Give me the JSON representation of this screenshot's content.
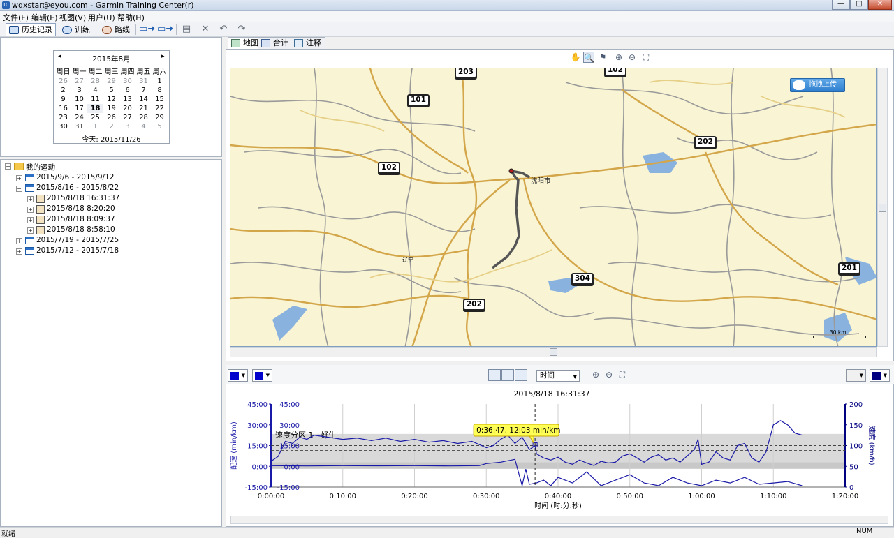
{
  "window": {
    "title": "wqxstar@eyou.com - Garmin Training Center(r)",
    "app_icon_text": "TC"
  },
  "menu": [
    "文件(F)",
    "编辑(E)",
    "视图(V)",
    "用户(U)",
    "帮助(H)"
  ],
  "toolbar": {
    "tabs": [
      "历史记录",
      "训练",
      "路线"
    ]
  },
  "calendar": {
    "month_label": "2015年8月",
    "weekdays": [
      "周日",
      "周一",
      "周二",
      "周三",
      "周四",
      "周五",
      "周六"
    ],
    "weeks": [
      [
        "26",
        "27",
        "28",
        "29",
        "30",
        "31",
        "1"
      ],
      [
        "2",
        "3",
        "4",
        "5",
        "6",
        "7",
        "8"
      ],
      [
        "9",
        "10",
        "11",
        "12",
        "13",
        "14",
        "15"
      ],
      [
        "16",
        "17",
        "18",
        "19",
        "20",
        "21",
        "22"
      ],
      [
        "23",
        "24",
        "25",
        "26",
        "27",
        "28",
        "29"
      ],
      [
        "30",
        "31",
        "1",
        "2",
        "3",
        "4",
        "5"
      ]
    ],
    "selected_day": "18",
    "today_label": "今天: 2015/11/26"
  },
  "tree": {
    "root": "我的运动",
    "nodes": [
      {
        "label": "2015/9/6 - 2015/9/12",
        "level": 1,
        "type": "week"
      },
      {
        "label": "2015/8/16 - 2015/8/22",
        "level": 1,
        "type": "week"
      },
      {
        "label": "2015/8/18 16:31:37",
        "level": 2,
        "type": "activity"
      },
      {
        "label": "2015/8/18 8:20:20",
        "level": 2,
        "type": "activity"
      },
      {
        "label": "2015/8/18 8:09:37",
        "level": 2,
        "type": "activity"
      },
      {
        "label": "2015/8/18 8:58:10",
        "level": 2,
        "type": "activity"
      },
      {
        "label": "2015/7/19 - 2015/7/25",
        "level": 1,
        "type": "week"
      },
      {
        "label": "2015/7/12 - 2015/7/18",
        "level": 1,
        "type": "week"
      }
    ]
  },
  "view_tabs": [
    "地图",
    "合计",
    "注释"
  ],
  "map": {
    "upload_button": "拖拽上传",
    "city_label": "沈阳市",
    "province_label": "辽宁",
    "scale_label": "30 km",
    "shields": [
      "203",
      "102",
      "101",
      "202",
      "102",
      "304",
      "202",
      "201"
    ]
  },
  "chart": {
    "title": "2015/8/18 16:31:37",
    "x_axis_selector": "时间",
    "tooltip": "0:36:47, 12:03 min/km",
    "zone_label": "速度分区 1 - 好生",
    "left_axis_label": "配速 (min/km)",
    "right_axis_label": "速度 (km/h)",
    "x_axis_label": "时间 (时:分:秒)",
    "left_ticks_outer": [
      "45:00",
      "30:00",
      "15:00",
      "0:00",
      "-15:00"
    ],
    "left_ticks_inner": [
      "45:00",
      "30:00",
      "15:00",
      "0:00",
      "-15:00"
    ],
    "right_ticks": [
      "200",
      "150",
      "100",
      "50",
      "0"
    ],
    "x_ticks": [
      "0:00:00",
      "0:10:00",
      "0:20:00",
      "0:30:00",
      "0:40:00",
      "0:50:00",
      "1:00:00",
      "1:10:00",
      "1:20:00"
    ],
    "line_color": "#1a1aa8"
  },
  "chart_data": {
    "type": "line",
    "title": "2015/8/18 16:31:37",
    "xlabel": "时间 (时:分:秒)",
    "ylabel": "配速 (min/km)",
    "y2label": "速度 (km/h)",
    "xlim_minutes": [
      0,
      80
    ],
    "ylim_pace_min": [
      -15,
      45
    ],
    "ylim_speed_kmh": [
      0,
      200
    ],
    "series": [
      {
        "axis": "right",
        "x_minutes": [
          0,
          1,
          2,
          3,
          4,
          5,
          6,
          8,
          10,
          12,
          14,
          16,
          18,
          20,
          22,
          24,
          26,
          28,
          30,
          31,
          32,
          33,
          34,
          35,
          36,
          36.8,
          37,
          38,
          39,
          40,
          41,
          42,
          43,
          44,
          45,
          46,
          47,
          48,
          49,
          50,
          51,
          52,
          53,
          54,
          55,
          56,
          57,
          58,
          59,
          59.5,
          60,
          61,
          62,
          63,
          64,
          65,
          66,
          67,
          68,
          69,
          70,
          71,
          72,
          73,
          74
        ],
        "values": [
          62,
          74,
          110,
          105,
          120,
          115,
          125,
          120,
          115,
          118,
          112,
          118,
          110,
          115,
          108,
          112,
          105,
          110,
          95,
          100,
          115,
          125,
          105,
          120,
          90,
          100,
          80,
          70,
          65,
          72,
          60,
          55,
          65,
          58,
          52,
          62,
          58,
          60,
          75,
          80,
          70,
          60,
          72,
          78,
          65,
          70,
          60,
          75,
          90,
          115,
          55,
          60,
          85,
          70,
          65,
          100,
          105,
          70,
          60,
          85,
          150,
          160,
          150,
          130,
          125
        ]
      },
      {
        "axis": "left",
        "x_minutes": [
          0,
          5,
          10,
          15,
          20,
          25,
          29,
          30,
          32,
          34,
          35,
          35.5,
          36,
          37,
          38,
          39,
          40,
          42,
          44,
          46,
          48,
          50,
          52,
          54,
          56,
          58,
          60,
          62,
          64,
          66,
          68,
          70,
          72,
          74
        ],
        "values": [
          0.5,
          0.3,
          0.5,
          0.4,
          0.5,
          0.3,
          0.5,
          2,
          3,
          5,
          -14,
          -2,
          -13,
          -12,
          -10,
          -14,
          -8,
          -12,
          -4,
          -14,
          -10,
          -6,
          -12,
          -14,
          -8,
          -12,
          -14,
          -10,
          -12,
          -8,
          -13,
          -12,
          -11,
          -14
        ]
      }
    ],
    "horizontal_markers": [
      {
        "axis": "right",
        "value": 100
      },
      {
        "axis": "right",
        "value": 88
      }
    ],
    "cursor_minutes": 36.8
  }
}
